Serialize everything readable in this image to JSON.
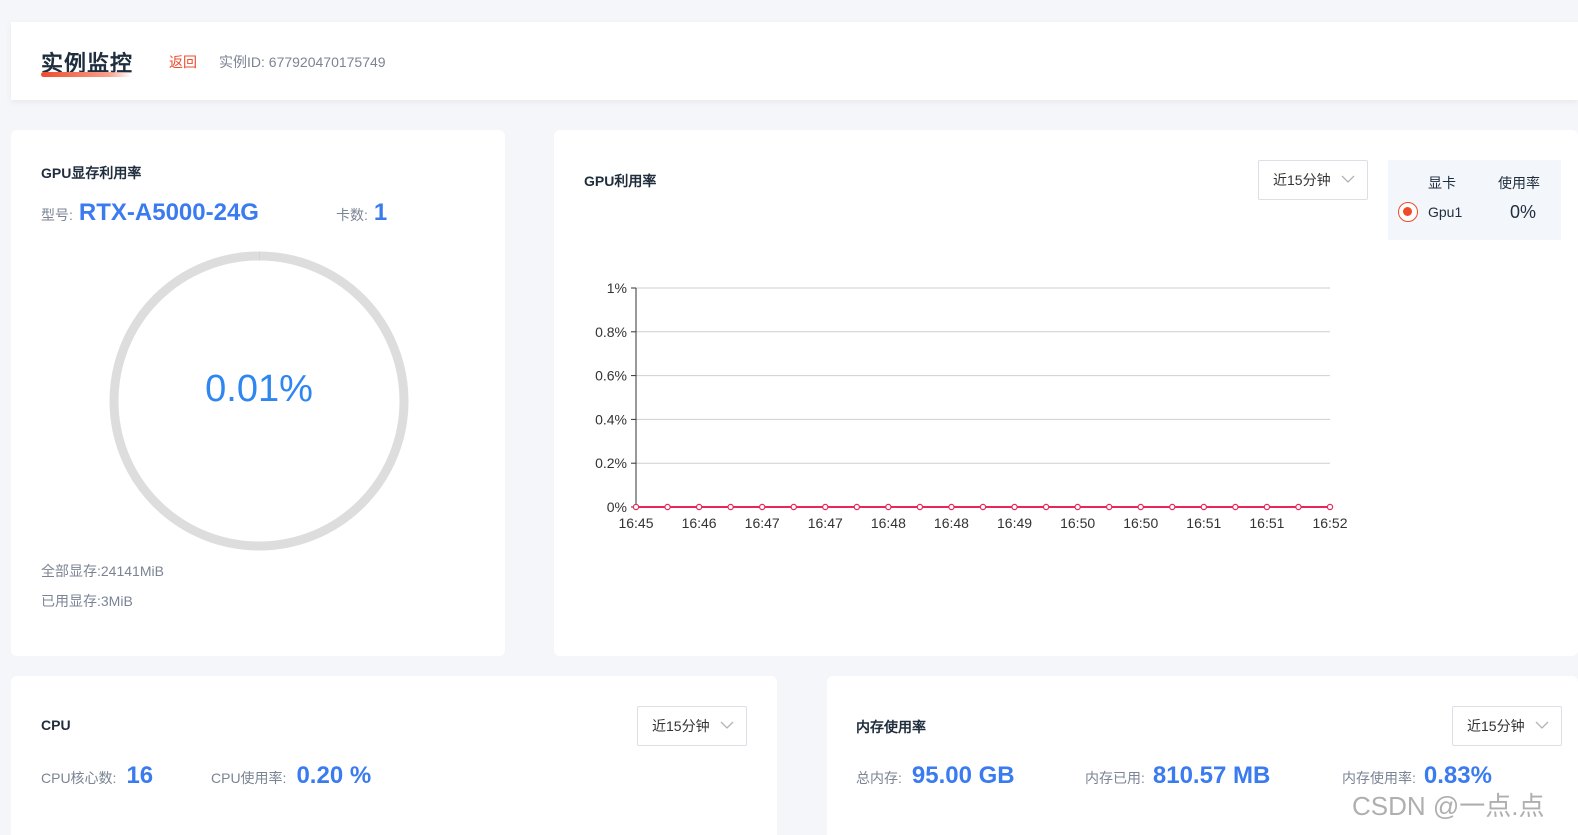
{
  "header": {
    "title": "实例监控",
    "back_label": "返回",
    "instance_id": "实例ID: 677920470175749"
  },
  "gpu_memory": {
    "title": "GPU显存利用率",
    "model_label": "型号:",
    "model_value": "RTX-A5000-24G",
    "cards_label": "卡数:",
    "cards_value": "1",
    "usage_text": "0.01%",
    "usage_fraction": 0.0001,
    "total_memory": "全部显存:24141MiB",
    "used_memory": "已用显存:3MiB"
  },
  "gpu_util": {
    "title": "GPU利用率",
    "range_select": "近15分钟",
    "legend": {
      "col_card": "显卡",
      "col_usage": "使用率",
      "gpu_name": "Gpu1",
      "gpu_usage": "0%"
    }
  },
  "chart_data": {
    "type": "line",
    "title": "",
    "xlabel": "",
    "ylabel": "",
    "x": [
      "16:45",
      "16:45",
      "16:46",
      "16:46",
      "16:47",
      "16:47",
      "16:47",
      "16:47",
      "16:48",
      "16:48",
      "16:48",
      "16:48",
      "16:49",
      "16:49",
      "16:50",
      "16:50",
      "16:50",
      "16:50",
      "16:51",
      "16:51",
      "16:51",
      "16:51",
      "16:52"
    ],
    "x_tick_labels": [
      "16:45",
      "16:46",
      "16:47",
      "16:47",
      "16:48",
      "16:48",
      "16:49",
      "16:50",
      "16:50",
      "16:51",
      "16:51",
      "16:52"
    ],
    "y_tick_labels": [
      "0%",
      "0.2%",
      "0.4%",
      "0.6%",
      "0.8%",
      "1%"
    ],
    "ylim": [
      0,
      1
    ],
    "grid": true,
    "series": [
      {
        "values": [
          0,
          0,
          0,
          0,
          0,
          0,
          0,
          0,
          0,
          0,
          0,
          0,
          0,
          0,
          0,
          0,
          0,
          0,
          0,
          0,
          0,
          0,
          0
        ],
        "color": "#e8265a"
      }
    ]
  },
  "cpu": {
    "title": "CPU",
    "range_select": "近15分钟",
    "cores_label": "CPU核心数:",
    "cores_value": "16",
    "usage_label": "CPU使用率:",
    "usage_value": "0.20 %"
  },
  "memory": {
    "title": "内存使用率",
    "range_select": "近15分钟",
    "total_label": "总内存:",
    "total_value": "95.00 GB",
    "used_label": "内存已用:",
    "used_value": "810.57 MB",
    "usage_label": "内存使用率:",
    "usage_value": "0.83%"
  },
  "watermark": "CSDN @一点.点",
  "colors": {
    "accent": "#ef4b2a",
    "value_blue": "#3a7bf0",
    "gauge_track": "#dddddd",
    "line": "#e8265a"
  },
  "icons": {
    "select_chevron": "chevron-down-icon"
  }
}
